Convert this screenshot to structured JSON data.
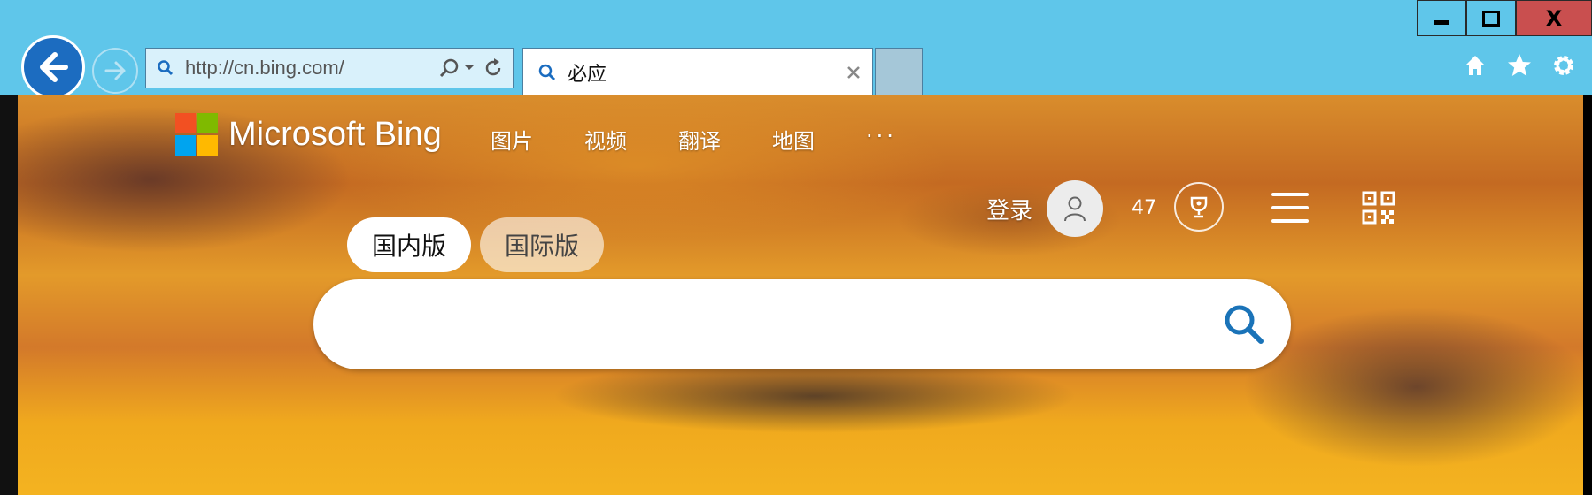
{
  "browser": {
    "address_url": "http://cn.bing.com/",
    "tab_title": "必应",
    "close_label": "X"
  },
  "bing": {
    "logo_text": "Microsoft Bing",
    "logo_colors": [
      "#f25022",
      "#7fba00",
      "#00a4ef",
      "#ffb900"
    ],
    "nav": [
      "图片",
      "视频",
      "翻译",
      "地图",
      "···"
    ],
    "signin": "登录",
    "points": "47",
    "scope_domestic": "国内版",
    "scope_international": "国际版",
    "search_value": "",
    "accent_color": "#1a73b8"
  }
}
